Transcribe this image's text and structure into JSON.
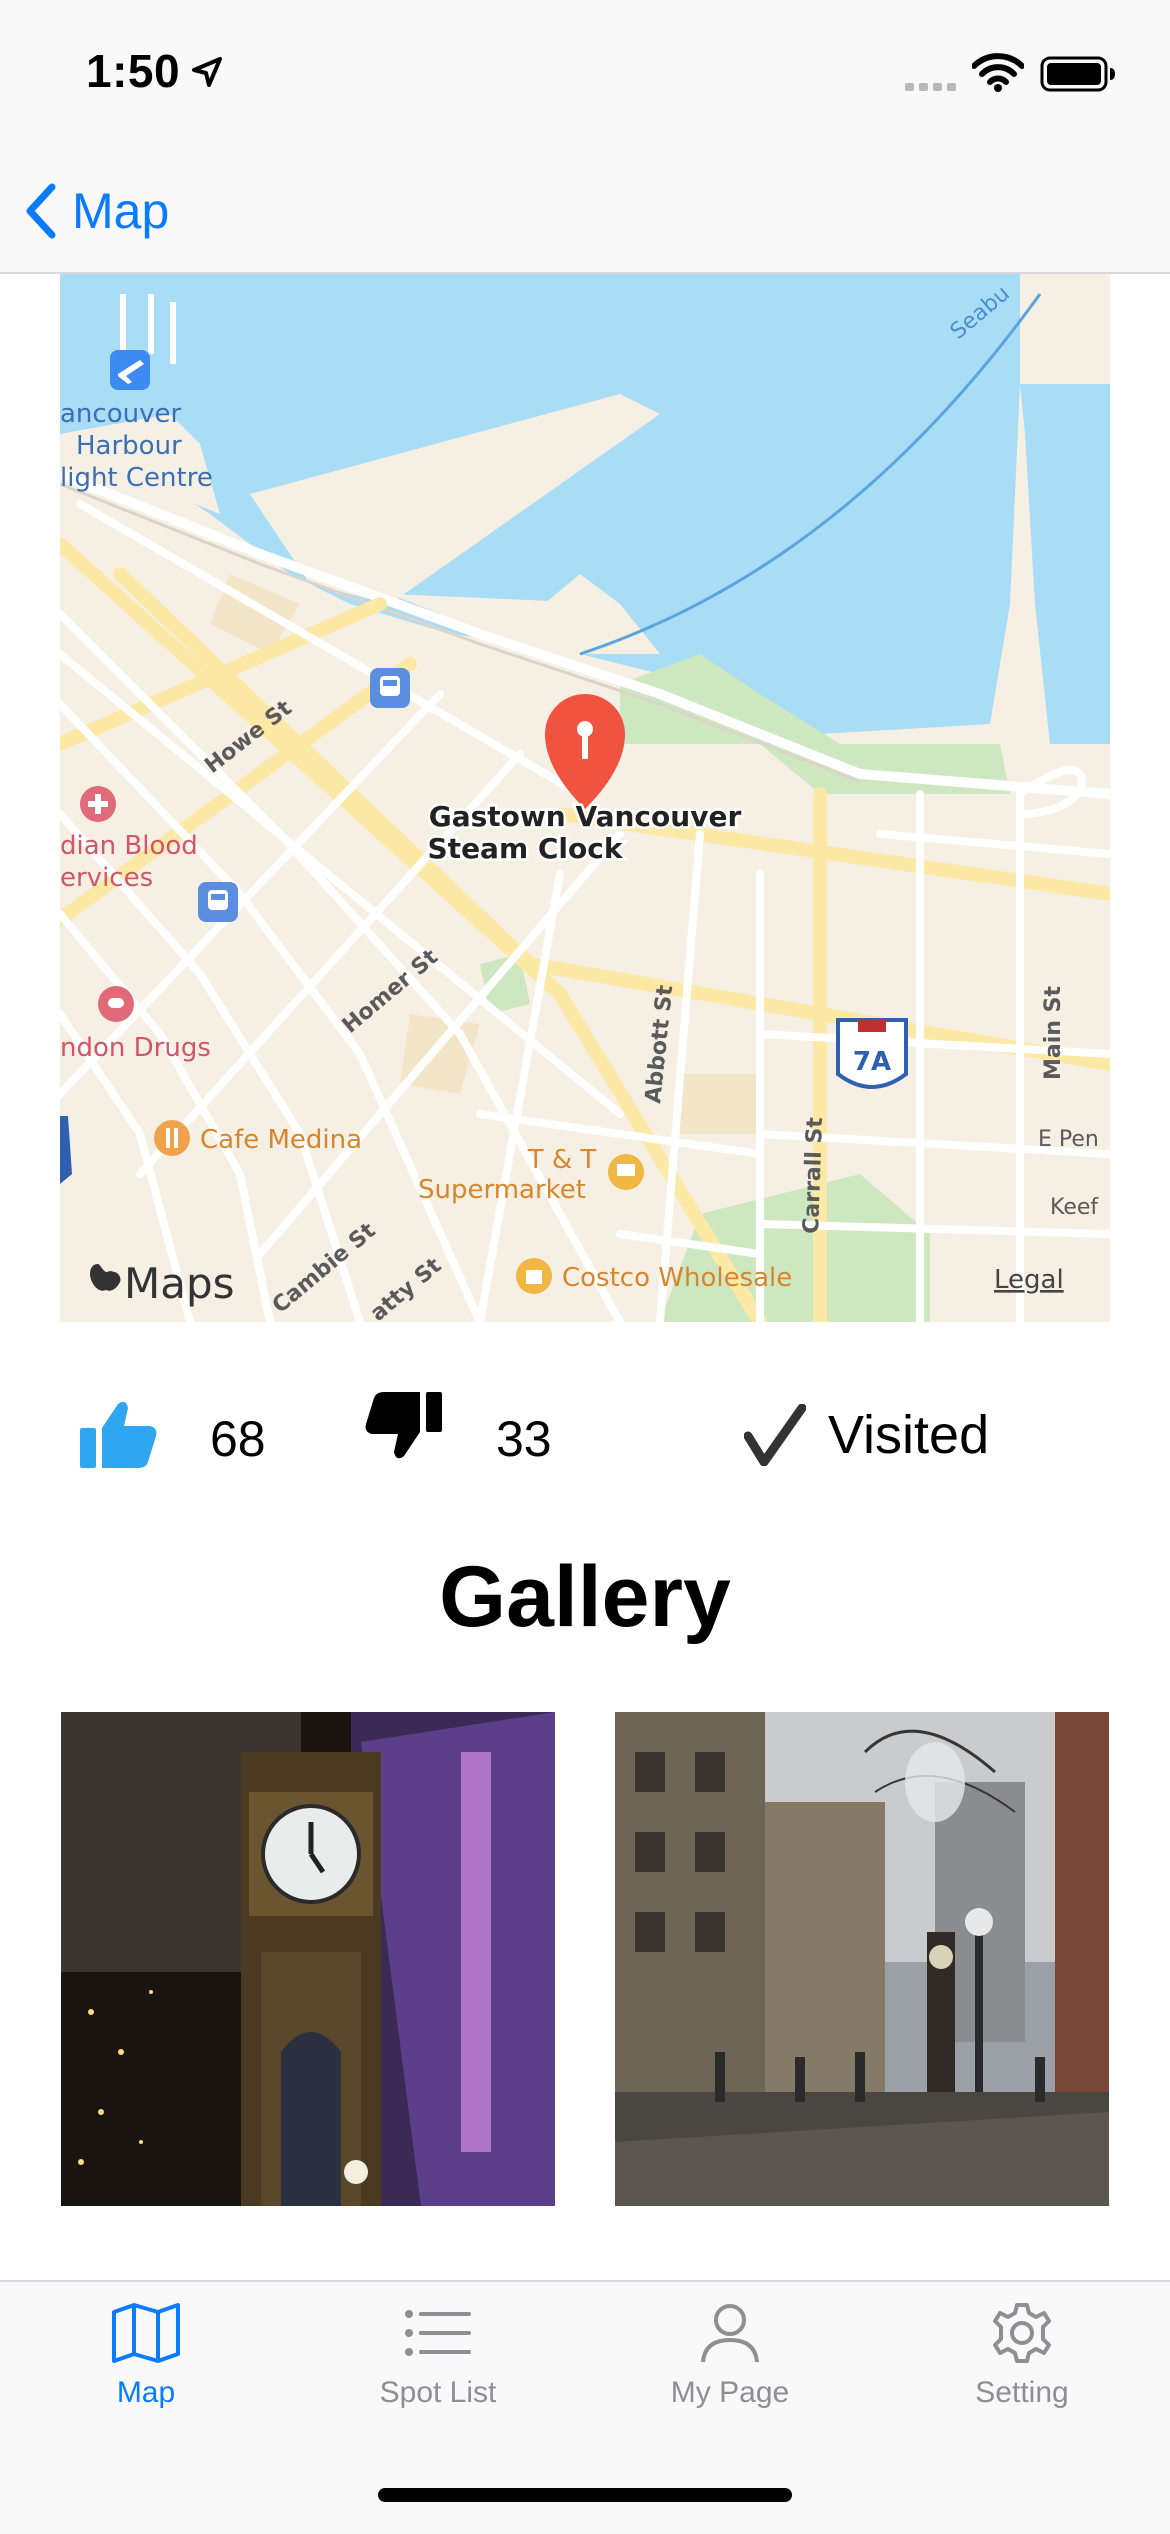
{
  "status_bar": {
    "time": "1:50"
  },
  "nav": {
    "back_label": "Map"
  },
  "map": {
    "pin_label_line1": "Gastown Vancouver",
    "pin_label_line2": "Steam Clock",
    "labels": {
      "harbour1": "ancouver",
      "harbour2": "Harbour",
      "harbour3": "light Centre",
      "blood1": "dian Blood",
      "blood2": "ervices",
      "drugs": "ndon Drugs",
      "cafe": "Cafe Medina",
      "tt1": "T & T",
      "tt2": "Supermarket",
      "costco": "Costco Wholesale",
      "howe": "Howe St",
      "homer": "Homer St",
      "cambie": "Cambie St",
      "beatty": "atty St",
      "abbott": "Abbott St",
      "carrall": "Carrall St",
      "main": "Main St",
      "pender": "E Pen",
      "keefer": "Keef",
      "seabus": "Seabu",
      "highway": "7A",
      "maps_brand": "Maps",
      "legal": "Legal"
    }
  },
  "stats": {
    "likes": "68",
    "dislikes": "33",
    "visited_label": "Visited"
  },
  "gallery": {
    "title": "Gallery"
  },
  "tabs": [
    {
      "label": "Map",
      "icon": "map-icon",
      "active": true
    },
    {
      "label": "Spot List",
      "icon": "list-icon",
      "active": false
    },
    {
      "label": "My Page",
      "icon": "person-icon",
      "active": false
    },
    {
      "label": "Setting",
      "icon": "gear-icon",
      "active": false
    }
  ],
  "colors": {
    "accent": "#0a7aff",
    "thumb_up": "#2ea7f0",
    "pin": "#f0533f",
    "water": "#a9dcf5"
  }
}
